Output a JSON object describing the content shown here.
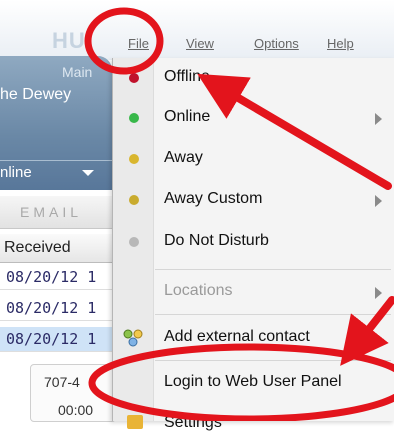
{
  "app": {
    "brand": "HU",
    "profile_main": "Main",
    "profile_name": "he Dewey",
    "presence_value": "nline",
    "email_tab": "EMAIL",
    "column_received": "Received",
    "rows": [
      "08/20/12 1",
      "08/20/12 1",
      "08/20/12 1"
    ],
    "phone_number": "707-4",
    "call_time": "00:00"
  },
  "menubar": {
    "file": "File",
    "view": "View",
    "options": "Options",
    "help": "Help"
  },
  "menu": {
    "items": [
      {
        "label": "Offline",
        "icon": "red-dot-icon",
        "color": "#c0122b"
      },
      {
        "label": "Online",
        "icon": "green-dot-icon",
        "color": "#38b84a"
      },
      {
        "label": "Away",
        "icon": "yellow-dot-icon",
        "color": "#d9b62e"
      },
      {
        "label": "Away Custom",
        "icon": "yellow-dot-icon",
        "color": "#c9ab2e"
      },
      {
        "label": "Do Not Disturb",
        "icon": "grey-dot-icon",
        "color": "#b8b8b8"
      },
      {
        "label": "Locations",
        "disabled": true
      },
      {
        "label": "Add external contact",
        "icon": "contacts-icon"
      },
      {
        "label": "Login to Web User Panel"
      },
      {
        "label": "Settings",
        "icon": "settings-icon"
      }
    ]
  },
  "annotation_color": "#e3141c"
}
